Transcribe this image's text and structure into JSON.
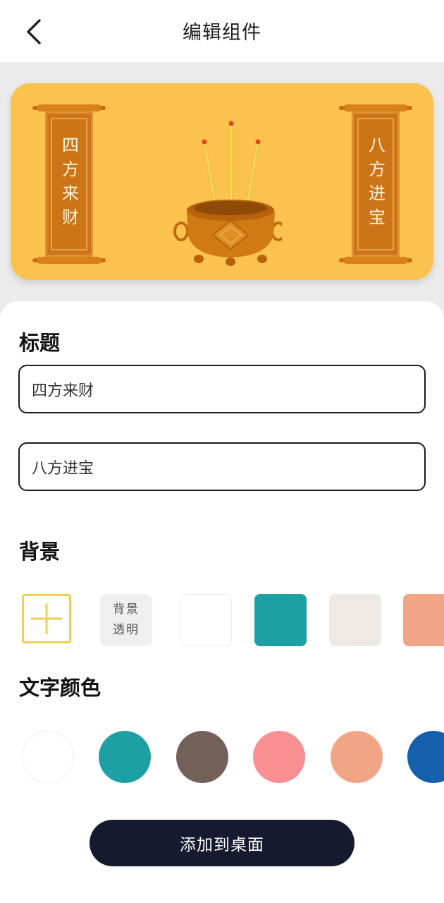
{
  "header": {
    "title": "编辑组件",
    "back_icon": "chevron-left-icon"
  },
  "preview": {
    "background_color": "#FBC24E",
    "left_scroll_text": "四方来财",
    "right_scroll_text": "八方进宝",
    "center_icon": "incense-burner-icon"
  },
  "title_section": {
    "heading": "标题",
    "input_1_value": "四方来财",
    "input_2_value": "八方进宝"
  },
  "background_section": {
    "heading": "背景",
    "add_icon": "plus-icon",
    "transparent_label_line1": "背景",
    "transparent_label_line2": "透明",
    "swatches": [
      "#FFFFFF",
      "#1CA0A3",
      "#EEE9E4",
      "#F2A585"
    ]
  },
  "text_color_section": {
    "heading": "文字颜色",
    "colors": [
      "#FFFFFF",
      "#1CA0A3",
      "#736159",
      "#F98E93",
      "#F2A585",
      "#1560AB"
    ]
  },
  "actions": {
    "add_to_desktop_label": "添加到桌面"
  }
}
